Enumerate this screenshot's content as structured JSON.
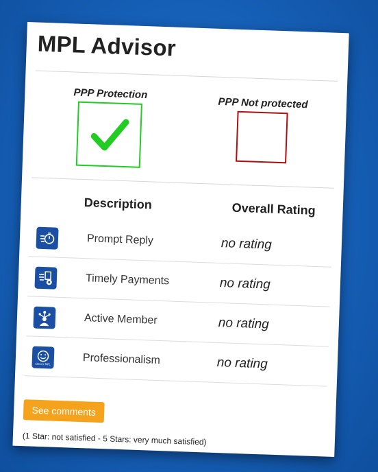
{
  "header": {
    "title": "MPL Advisor"
  },
  "ppp": {
    "protected_label": "PPP Protection",
    "not_protected_label": "PPP Not protected"
  },
  "table": {
    "col_description": "Description",
    "col_rating": "Overall Rating",
    "rows": [
      {
        "icon": "stopwatch-icon",
        "label": "Prompt Reply",
        "rating": "no rating"
      },
      {
        "icon": "payment-document-icon",
        "label": "Timely Payments",
        "rating": "no rating"
      },
      {
        "icon": "member-network-icon",
        "label": "Active Member",
        "rating": "no rating"
      },
      {
        "icon": "smiley-badge-icon",
        "label": "Professionalism",
        "rating": "no rating",
        "icon_caption": "Clever MPL"
      }
    ]
  },
  "actions": {
    "see_comments_label": "See comments"
  },
  "legend": {
    "text": "(1 Star: not satisfied - 5 Stars: very much satisfied)"
  },
  "colors": {
    "background": "#1660b8",
    "icon_blue": "#1a4fa3",
    "check_green": "#22cc22",
    "box_red": "#aa1111",
    "button_orange": "#f5a31c"
  }
}
